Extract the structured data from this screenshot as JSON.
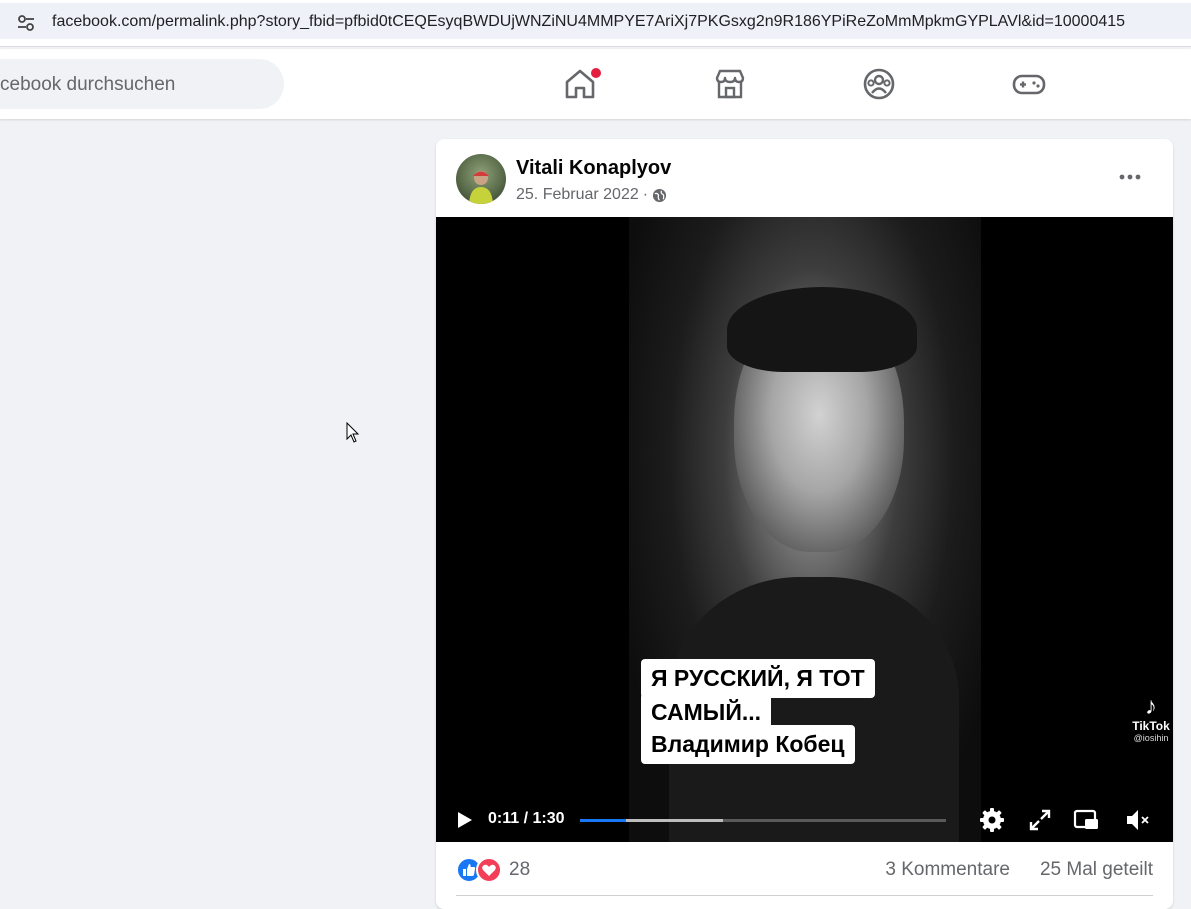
{
  "browser": {
    "url": "facebook.com/permalink.php?story_fbid=pfbid0tCEQEsyqBWDUjWNZiNU4MMPYE7AriXj7PKGsxg2n9R186YPiReZoMmMpkmGYPLAVl&id=10000415"
  },
  "header": {
    "search_placeholder": "cebook durchsuchen",
    "nav": [
      {
        "icon": "home-icon",
        "notification": true
      },
      {
        "icon": "marketplace-icon"
      },
      {
        "icon": "groups-icon"
      },
      {
        "icon": "gaming-icon"
      }
    ],
    "notification_color": "#e41e3f"
  },
  "post": {
    "author": "Vitali Konaplyov",
    "date": "25. Februar 2022",
    "separator": "·",
    "privacy_icon": "globe-icon",
    "video": {
      "caption_lines": [
        "Я РУССКИЙ, Я ТОТ",
        "САМЫЙ...",
        "Владимир Кобец"
      ],
      "watermark": "TikTok",
      "watermark_handle": "@iosihin",
      "time": "0:11 / 1:30",
      "progress": 0.127,
      "buffered": 0.39
    },
    "reaction_count": "28",
    "comments": "3 Kommentare",
    "shares": "25 Mal geteilt"
  },
  "colors": {
    "accent": "#1877f2",
    "like": "#1877f2",
    "love": "#f33e58",
    "page_bg": "#f0f2f5"
  }
}
